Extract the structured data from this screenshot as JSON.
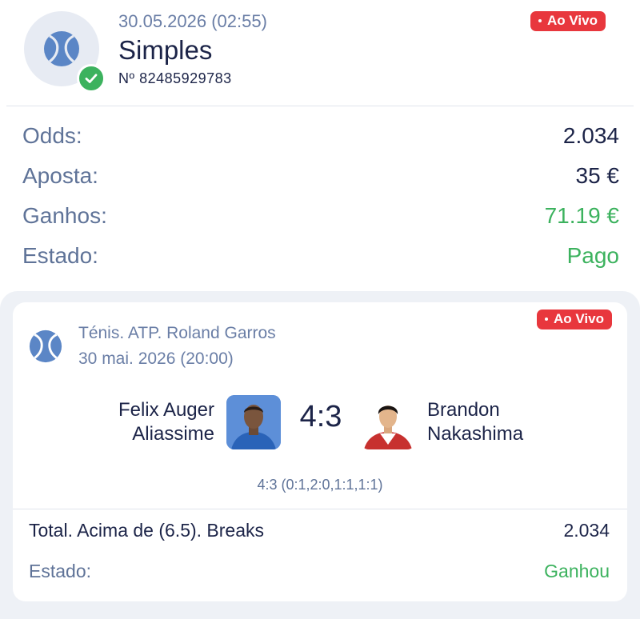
{
  "bet": {
    "datetime": "30.05.2026 (02:55)",
    "type": "Simples",
    "number": "Nº 82485929783",
    "live_badge": "Ao Vivo",
    "sport_icon": "tennis-ball-icon",
    "status_icon": "check-icon"
  },
  "summary": {
    "odds_label": "Odds:",
    "odds_value": "2.034",
    "stake_label": "Aposta:",
    "stake_value": "35 €",
    "winnings_label": "Ganhos:",
    "winnings_value": "71.19 €",
    "state_label": "Estado:",
    "state_value": "Pago"
  },
  "event": {
    "league": "Ténis. ATP. Roland Garros",
    "date": "30 mai. 2026 (20:00)",
    "live_badge": "Ao Vivo",
    "player1_line1": "Felix Auger",
    "player1_line2": "Aliassime",
    "player2_line1": "Brandon",
    "player2_line2": "Nakashima",
    "score": "4:3",
    "set_scores": "4:3 (0:1,2:0,1:1,1:1)",
    "market": "Total. Acima de (6.5). Breaks",
    "market_odds": "2.034",
    "state_label": "Estado:",
    "state_value": "Ganhou"
  },
  "colors": {
    "primary_text": "#1c2448",
    "secondary_text": "#6a7ea6",
    "success": "#3cb25e",
    "live": "#e8373d"
  }
}
